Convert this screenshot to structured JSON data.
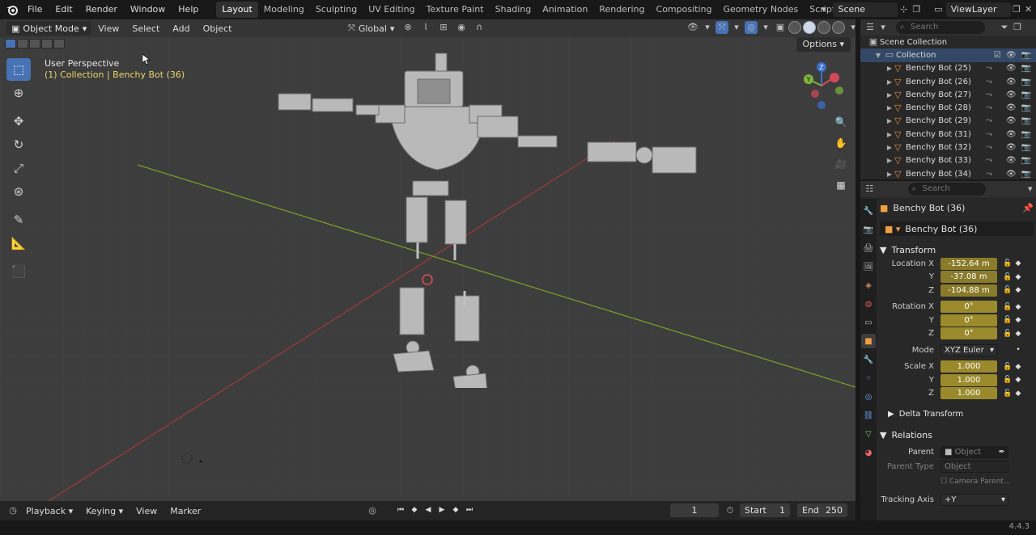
{
  "menus": [
    "File",
    "Edit",
    "Render",
    "Window",
    "Help"
  ],
  "workspaces": [
    "Layout",
    "Modeling",
    "Sculpting",
    "UV Editing",
    "Texture Paint",
    "Shading",
    "Animation",
    "Rendering",
    "Compositing",
    "Geometry Nodes",
    "Scripting"
  ],
  "active_workspace": "Layout",
  "scene": "Scene",
  "view_layer": "ViewLayer",
  "viewport": {
    "mode": "Object Mode",
    "menus": [
      "View",
      "Select",
      "Add",
      "Object"
    ],
    "orientation": "Global",
    "options_label": "Options",
    "perspective": "User Perspective",
    "collection_info": "(1) Collection | Benchy Bot (36)"
  },
  "outliner": {
    "search_placeholder": "Search",
    "scene_collection": "Scene Collection",
    "collection": "Collection",
    "items": [
      "Benchy Bot (25)",
      "Benchy Bot (26)",
      "Benchy Bot (27)",
      "Benchy Bot (28)",
      "Benchy Bot (29)",
      "Benchy Bot (31)",
      "Benchy Bot (32)",
      "Benchy Bot (33)",
      "Benchy Bot (34)"
    ]
  },
  "properties": {
    "search_placeholder": "Search",
    "object_name": "Benchy Bot (36)",
    "object_field": "Benchy Bot (36)",
    "transform_label": "Transform",
    "location": {
      "label": "Location X",
      "x": "-152.64 m",
      "y": "-37.08 m",
      "z": "-104.88 m"
    },
    "rotation": {
      "label": "Rotation X",
      "x": "0°",
      "y": "0°",
      "z": "0°"
    },
    "mode_label": "Mode",
    "mode_value": "XYZ Euler",
    "scale": {
      "label": "Scale X",
      "x": "1.000",
      "y": "1.000",
      "z": "1.000"
    },
    "delta_transform": "Delta Transform",
    "relations": "Relations",
    "parent_label": "Parent",
    "parent_placeholder": "Object",
    "parent_type_label": "Parent Type",
    "parent_type_value": "Object",
    "camera_parent": "Camera Parent...",
    "tracking_axis_label": "Tracking Axis",
    "tracking_axis_value": "+Y",
    "axis_y": "Y",
    "axis_z": "Z"
  },
  "timeline": {
    "menus": [
      "Playback",
      "Keying",
      "View",
      "Marker"
    ],
    "current_frame": "1",
    "start_label": "Start",
    "start_value": "1",
    "end_label": "End",
    "end_value": "250"
  },
  "version": "4.4.3",
  "colors": {
    "accent": "#4772b3",
    "animated_field": "#8a7b2a",
    "collection_info": "#e6d76a",
    "object_icon": "#e58c3a"
  }
}
